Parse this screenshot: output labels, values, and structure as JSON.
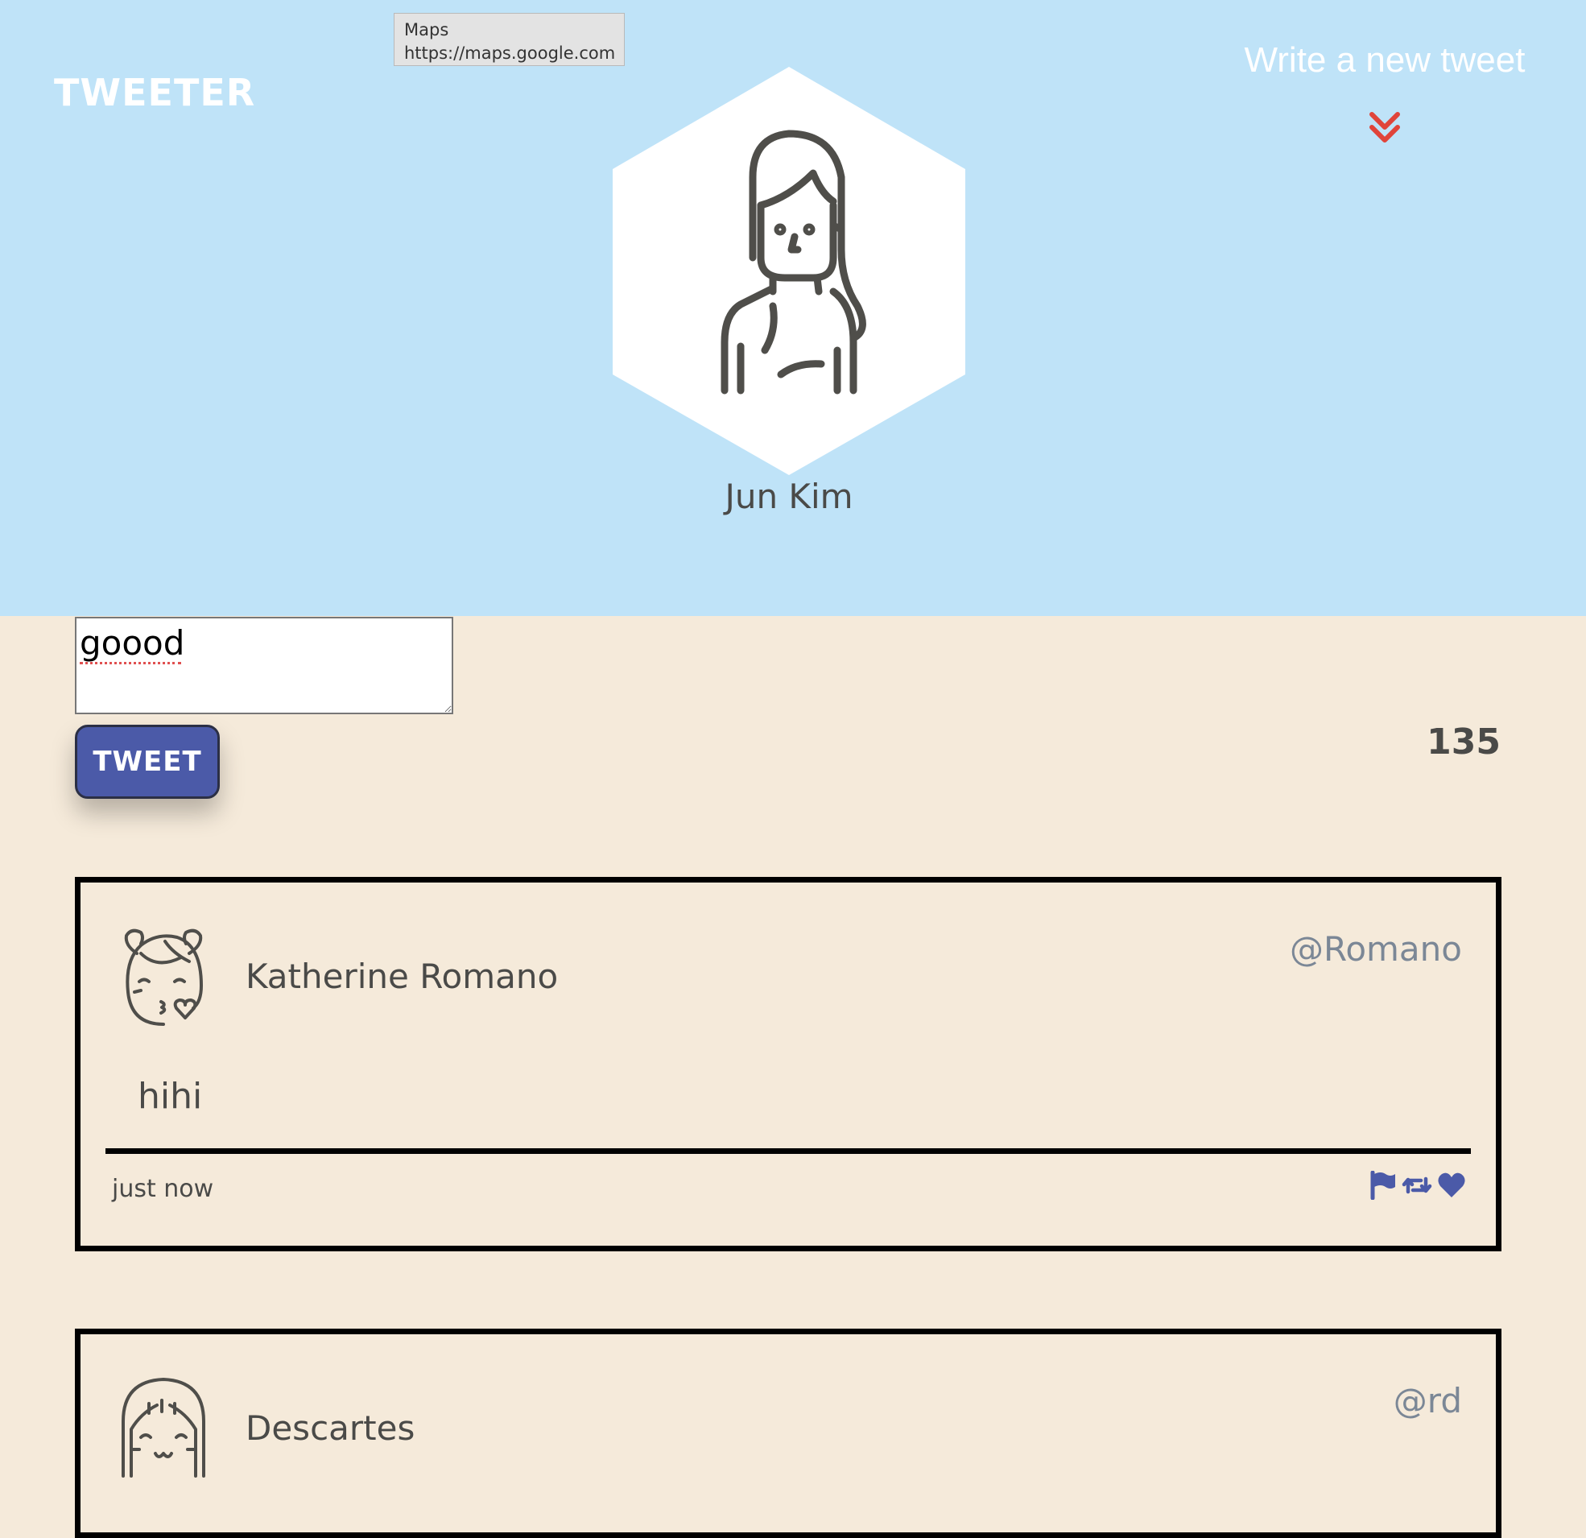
{
  "header": {
    "brand": "TWEETER",
    "compose_toggle_label": "Write a new tweet",
    "profile_name": "Jun Kim",
    "background_color": "#bfe3f8",
    "chevron_color": "#e0443a"
  },
  "tooltip": {
    "title": "Maps",
    "url": "https://maps.google.com"
  },
  "composer": {
    "value": "goood",
    "button_label": "TWEET",
    "char_counter": "135"
  },
  "tweets": [
    {
      "name": "Katherine Romano",
      "handle": "@Romano",
      "content": "hihi",
      "time": "just now",
      "avatar_icon": "kissing-face-icon",
      "actions": [
        "flag-icon",
        "retweet-icon",
        "heart-icon"
      ]
    },
    {
      "name": "Descartes",
      "handle": "@rd",
      "avatar_icon": "smiling-girl-icon"
    }
  ],
  "colors": {
    "page_background": "#f5eada",
    "accent": "#4b5aa8",
    "text": "#4a4a48",
    "handle": "#7b8796"
  }
}
